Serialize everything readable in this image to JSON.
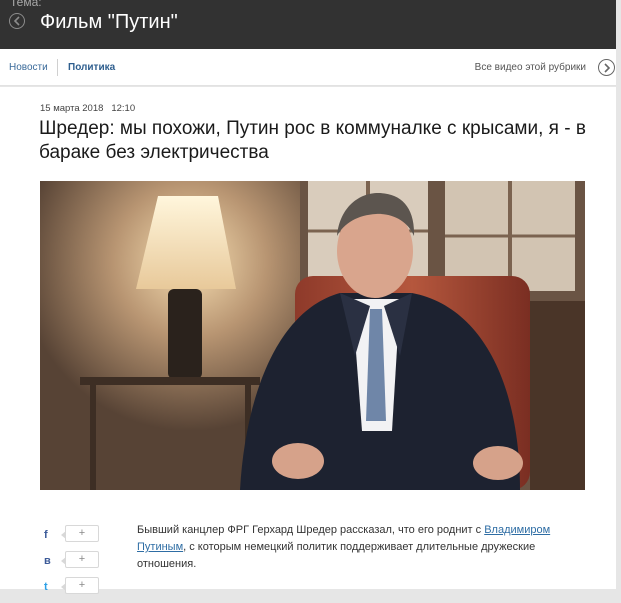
{
  "header": {
    "topic_label": "Тема:",
    "topic_title": "Фильм \"Путин\""
  },
  "nav": {
    "news": "Новости",
    "politics": "Политика",
    "all_videos": "Все видео этой рубрики"
  },
  "article": {
    "date": "15 марта 2018",
    "time": "12:10",
    "headline": "Шредер: мы похожи, Путин рос в коммуналке с крысами, я - в бараке без электричества",
    "lead_part1": "Бывший канцлер ФРГ Герхард Шредер рассказал, что его роднит с ",
    "lead_link": "Владимиром Путиным",
    "lead_part2": ", с которым немецкий политик поддерживает длительные дружеские отношения."
  },
  "social": [
    {
      "icon": "facebook-icon",
      "glyph": "f",
      "plus": "+"
    },
    {
      "icon": "vkontakte-icon",
      "glyph": "в",
      "plus": "+"
    },
    {
      "icon": "twitter-icon",
      "glyph": "t",
      "plus": "+"
    }
  ],
  "colors": {
    "topbar": "#323232",
    "link": "#2e6da4",
    "accent": "#3b5a98"
  }
}
